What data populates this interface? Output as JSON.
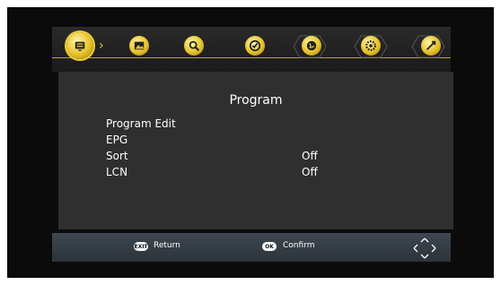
{
  "tabs": [
    {
      "icon": "tv-icon",
      "active": true
    },
    {
      "icon": "picture-icon",
      "active": false
    },
    {
      "icon": "search-icon",
      "active": false
    },
    {
      "icon": "clock-icon",
      "active": false
    },
    {
      "icon": "globe-icon",
      "active": false
    },
    {
      "icon": "gear-icon",
      "active": false
    },
    {
      "icon": "usb-icon",
      "active": false
    }
  ],
  "menu": {
    "title": "Program",
    "items": [
      {
        "label": "Program Edit",
        "value": ""
      },
      {
        "label": "EPG",
        "value": ""
      },
      {
        "label": "Sort",
        "value": "Off"
      },
      {
        "label": "LCN",
        "value": "Off"
      }
    ]
  },
  "footer": {
    "exit_badge": "EXIT",
    "return_label": "Return",
    "ok_badge": "OK",
    "confirm_label": "Confirm"
  },
  "colors": {
    "accent": "#e6c12a",
    "panel": "#2f2f2f",
    "footer": "#39424a"
  }
}
